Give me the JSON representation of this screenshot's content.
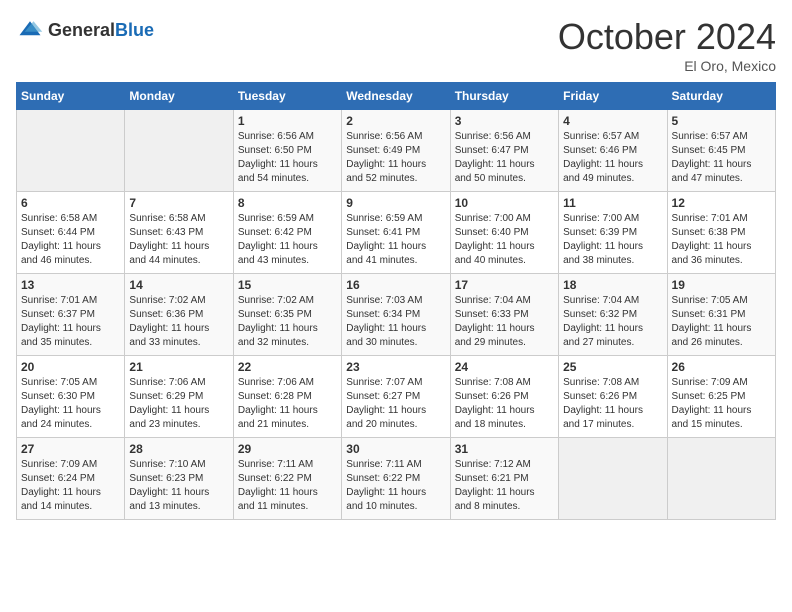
{
  "header": {
    "logo_general": "General",
    "logo_blue": "Blue",
    "title": "October 2024",
    "subtitle": "El Oro, Mexico"
  },
  "days_of_week": [
    "Sunday",
    "Monday",
    "Tuesday",
    "Wednesday",
    "Thursday",
    "Friday",
    "Saturday"
  ],
  "weeks": [
    [
      {
        "day": "",
        "info": ""
      },
      {
        "day": "",
        "info": ""
      },
      {
        "day": "1",
        "info": "Sunrise: 6:56 AM\nSunset: 6:50 PM\nDaylight: 11 hours\nand 54 minutes."
      },
      {
        "day": "2",
        "info": "Sunrise: 6:56 AM\nSunset: 6:49 PM\nDaylight: 11 hours\nand 52 minutes."
      },
      {
        "day": "3",
        "info": "Sunrise: 6:56 AM\nSunset: 6:47 PM\nDaylight: 11 hours\nand 50 minutes."
      },
      {
        "day": "4",
        "info": "Sunrise: 6:57 AM\nSunset: 6:46 PM\nDaylight: 11 hours\nand 49 minutes."
      },
      {
        "day": "5",
        "info": "Sunrise: 6:57 AM\nSunset: 6:45 PM\nDaylight: 11 hours\nand 47 minutes."
      }
    ],
    [
      {
        "day": "6",
        "info": "Sunrise: 6:58 AM\nSunset: 6:44 PM\nDaylight: 11 hours\nand 46 minutes."
      },
      {
        "day": "7",
        "info": "Sunrise: 6:58 AM\nSunset: 6:43 PM\nDaylight: 11 hours\nand 44 minutes."
      },
      {
        "day": "8",
        "info": "Sunrise: 6:59 AM\nSunset: 6:42 PM\nDaylight: 11 hours\nand 43 minutes."
      },
      {
        "day": "9",
        "info": "Sunrise: 6:59 AM\nSunset: 6:41 PM\nDaylight: 11 hours\nand 41 minutes."
      },
      {
        "day": "10",
        "info": "Sunrise: 7:00 AM\nSunset: 6:40 PM\nDaylight: 11 hours\nand 40 minutes."
      },
      {
        "day": "11",
        "info": "Sunrise: 7:00 AM\nSunset: 6:39 PM\nDaylight: 11 hours\nand 38 minutes."
      },
      {
        "day": "12",
        "info": "Sunrise: 7:01 AM\nSunset: 6:38 PM\nDaylight: 11 hours\nand 36 minutes."
      }
    ],
    [
      {
        "day": "13",
        "info": "Sunrise: 7:01 AM\nSunset: 6:37 PM\nDaylight: 11 hours\nand 35 minutes."
      },
      {
        "day": "14",
        "info": "Sunrise: 7:02 AM\nSunset: 6:36 PM\nDaylight: 11 hours\nand 33 minutes."
      },
      {
        "day": "15",
        "info": "Sunrise: 7:02 AM\nSunset: 6:35 PM\nDaylight: 11 hours\nand 32 minutes."
      },
      {
        "day": "16",
        "info": "Sunrise: 7:03 AM\nSunset: 6:34 PM\nDaylight: 11 hours\nand 30 minutes."
      },
      {
        "day": "17",
        "info": "Sunrise: 7:04 AM\nSunset: 6:33 PM\nDaylight: 11 hours\nand 29 minutes."
      },
      {
        "day": "18",
        "info": "Sunrise: 7:04 AM\nSunset: 6:32 PM\nDaylight: 11 hours\nand 27 minutes."
      },
      {
        "day": "19",
        "info": "Sunrise: 7:05 AM\nSunset: 6:31 PM\nDaylight: 11 hours\nand 26 minutes."
      }
    ],
    [
      {
        "day": "20",
        "info": "Sunrise: 7:05 AM\nSunset: 6:30 PM\nDaylight: 11 hours\nand 24 minutes."
      },
      {
        "day": "21",
        "info": "Sunrise: 7:06 AM\nSunset: 6:29 PM\nDaylight: 11 hours\nand 23 minutes."
      },
      {
        "day": "22",
        "info": "Sunrise: 7:06 AM\nSunset: 6:28 PM\nDaylight: 11 hours\nand 21 minutes."
      },
      {
        "day": "23",
        "info": "Sunrise: 7:07 AM\nSunset: 6:27 PM\nDaylight: 11 hours\nand 20 minutes."
      },
      {
        "day": "24",
        "info": "Sunrise: 7:08 AM\nSunset: 6:26 PM\nDaylight: 11 hours\nand 18 minutes."
      },
      {
        "day": "25",
        "info": "Sunrise: 7:08 AM\nSunset: 6:26 PM\nDaylight: 11 hours\nand 17 minutes."
      },
      {
        "day": "26",
        "info": "Sunrise: 7:09 AM\nSunset: 6:25 PM\nDaylight: 11 hours\nand 15 minutes."
      }
    ],
    [
      {
        "day": "27",
        "info": "Sunrise: 7:09 AM\nSunset: 6:24 PM\nDaylight: 11 hours\nand 14 minutes."
      },
      {
        "day": "28",
        "info": "Sunrise: 7:10 AM\nSunset: 6:23 PM\nDaylight: 11 hours\nand 13 minutes."
      },
      {
        "day": "29",
        "info": "Sunrise: 7:11 AM\nSunset: 6:22 PM\nDaylight: 11 hours\nand 11 minutes."
      },
      {
        "day": "30",
        "info": "Sunrise: 7:11 AM\nSunset: 6:22 PM\nDaylight: 11 hours\nand 10 minutes."
      },
      {
        "day": "31",
        "info": "Sunrise: 7:12 AM\nSunset: 6:21 PM\nDaylight: 11 hours\nand 8 minutes."
      },
      {
        "day": "",
        "info": ""
      },
      {
        "day": "",
        "info": ""
      }
    ]
  ]
}
